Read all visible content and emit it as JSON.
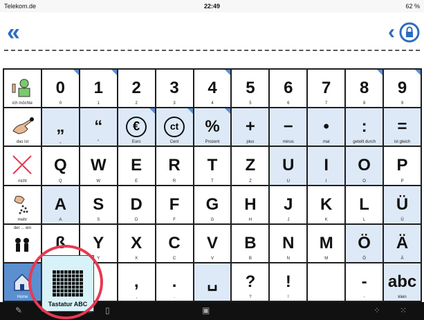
{
  "status_bar": {
    "carrier": "Telekom.de",
    "time": "22:49",
    "battery": "62 %"
  },
  "header": {
    "back_icon": "double-chevron-left-icon",
    "prev_icon": "chevron-left-icon",
    "lock_icon": "lock-icon"
  },
  "grid": {
    "row1": [
      {
        "label": "ich möchte",
        "icon": "person-speaking-icon"
      },
      {
        "big": "0",
        "label": "0"
      },
      {
        "big": "1",
        "label": "1"
      },
      {
        "big": "2",
        "label": "2"
      },
      {
        "big": "3",
        "label": "3"
      },
      {
        "big": "4",
        "label": "4"
      },
      {
        "big": "5",
        "label": "5"
      },
      {
        "big": "6",
        "label": "6"
      },
      {
        "big": "7",
        "label": "7"
      },
      {
        "big": "8",
        "label": "8"
      },
      {
        "big": "9",
        "label": "9"
      }
    ],
    "row2": [
      {
        "label": "das ist",
        "icon": "pointing-hand-icon"
      },
      {
        "big": "„",
        "label": "„"
      },
      {
        "big": "“",
        "label": "“"
      },
      {
        "big": "€",
        "label": "Euro"
      },
      {
        "big": "ct",
        "label": "Cent"
      },
      {
        "big": "%",
        "label": "Prozent"
      },
      {
        "big": "+",
        "label": "plus"
      },
      {
        "big": "−",
        "label": "minus"
      },
      {
        "big": "•",
        "label": "mal"
      },
      {
        "big": ":",
        "label": "geteilt durch"
      },
      {
        "big": "=",
        "label": "ist gleich"
      }
    ],
    "row3": [
      {
        "label": "nicht",
        "icon": "cross-icon"
      },
      {
        "big": "Q",
        "label": "Q"
      },
      {
        "big": "W",
        "label": "W"
      },
      {
        "big": "E",
        "label": "E"
      },
      {
        "big": "R",
        "label": "R"
      },
      {
        "big": "T",
        "label": "T"
      },
      {
        "big": "Z",
        "label": "Z"
      },
      {
        "big": "U",
        "label": "U"
      },
      {
        "big": "I",
        "label": "I"
      },
      {
        "big": "O",
        "label": "O"
      },
      {
        "big": "P",
        "label": "P"
      }
    ],
    "row4": [
      {
        "label": "mehr",
        "icon": "hand-pouring-icon"
      },
      {
        "big": "A",
        "label": "A"
      },
      {
        "big": "S",
        "label": "S"
      },
      {
        "big": "D",
        "label": "D"
      },
      {
        "big": "F",
        "label": "F"
      },
      {
        "big": "G",
        "label": "G"
      },
      {
        "big": "H",
        "label": "H"
      },
      {
        "big": "J",
        "label": "J"
      },
      {
        "big": "K",
        "label": "K"
      },
      {
        "big": "L",
        "label": "L"
      },
      {
        "big": "Ü",
        "label": "Ü"
      }
    ],
    "row5": [
      {
        "label": "der ... ein",
        "icon": "people-icon"
      },
      {
        "big": "ß",
        "label": "ß"
      },
      {
        "big": "Y",
        "label": "Y"
      },
      {
        "big": "X",
        "label": "X"
      },
      {
        "big": "C",
        "label": "C"
      },
      {
        "big": "V",
        "label": "V"
      },
      {
        "big": "B",
        "label": "B"
      },
      {
        "big": "N",
        "label": "N"
      },
      {
        "big": "M",
        "label": "M"
      },
      {
        "big": "Ö",
        "label": "Ö"
      },
      {
        "big": "Ä",
        "label": "Ä"
      }
    ],
    "row6": [
      {
        "label": "Home",
        "icon": "house-icon"
      },
      {
        "big": "",
        "label": ""
      },
      {
        "big": "",
        "label": ""
      },
      {
        "big": ",",
        "label": ","
      },
      {
        "big": ".",
        "label": "."
      },
      {
        "big": "␣",
        "label": ""
      },
      {
        "big": "?",
        "label": "?"
      },
      {
        "big": "!",
        "label": "!"
      },
      {
        "big": "",
        "label": ""
      },
      {
        "big": "-",
        "label": "-"
      },
      {
        "big": "abc",
        "label": "klein"
      }
    ]
  },
  "popup": {
    "label": "Tastatur ABC",
    "icon": "keyboard-grid-icon"
  }
}
